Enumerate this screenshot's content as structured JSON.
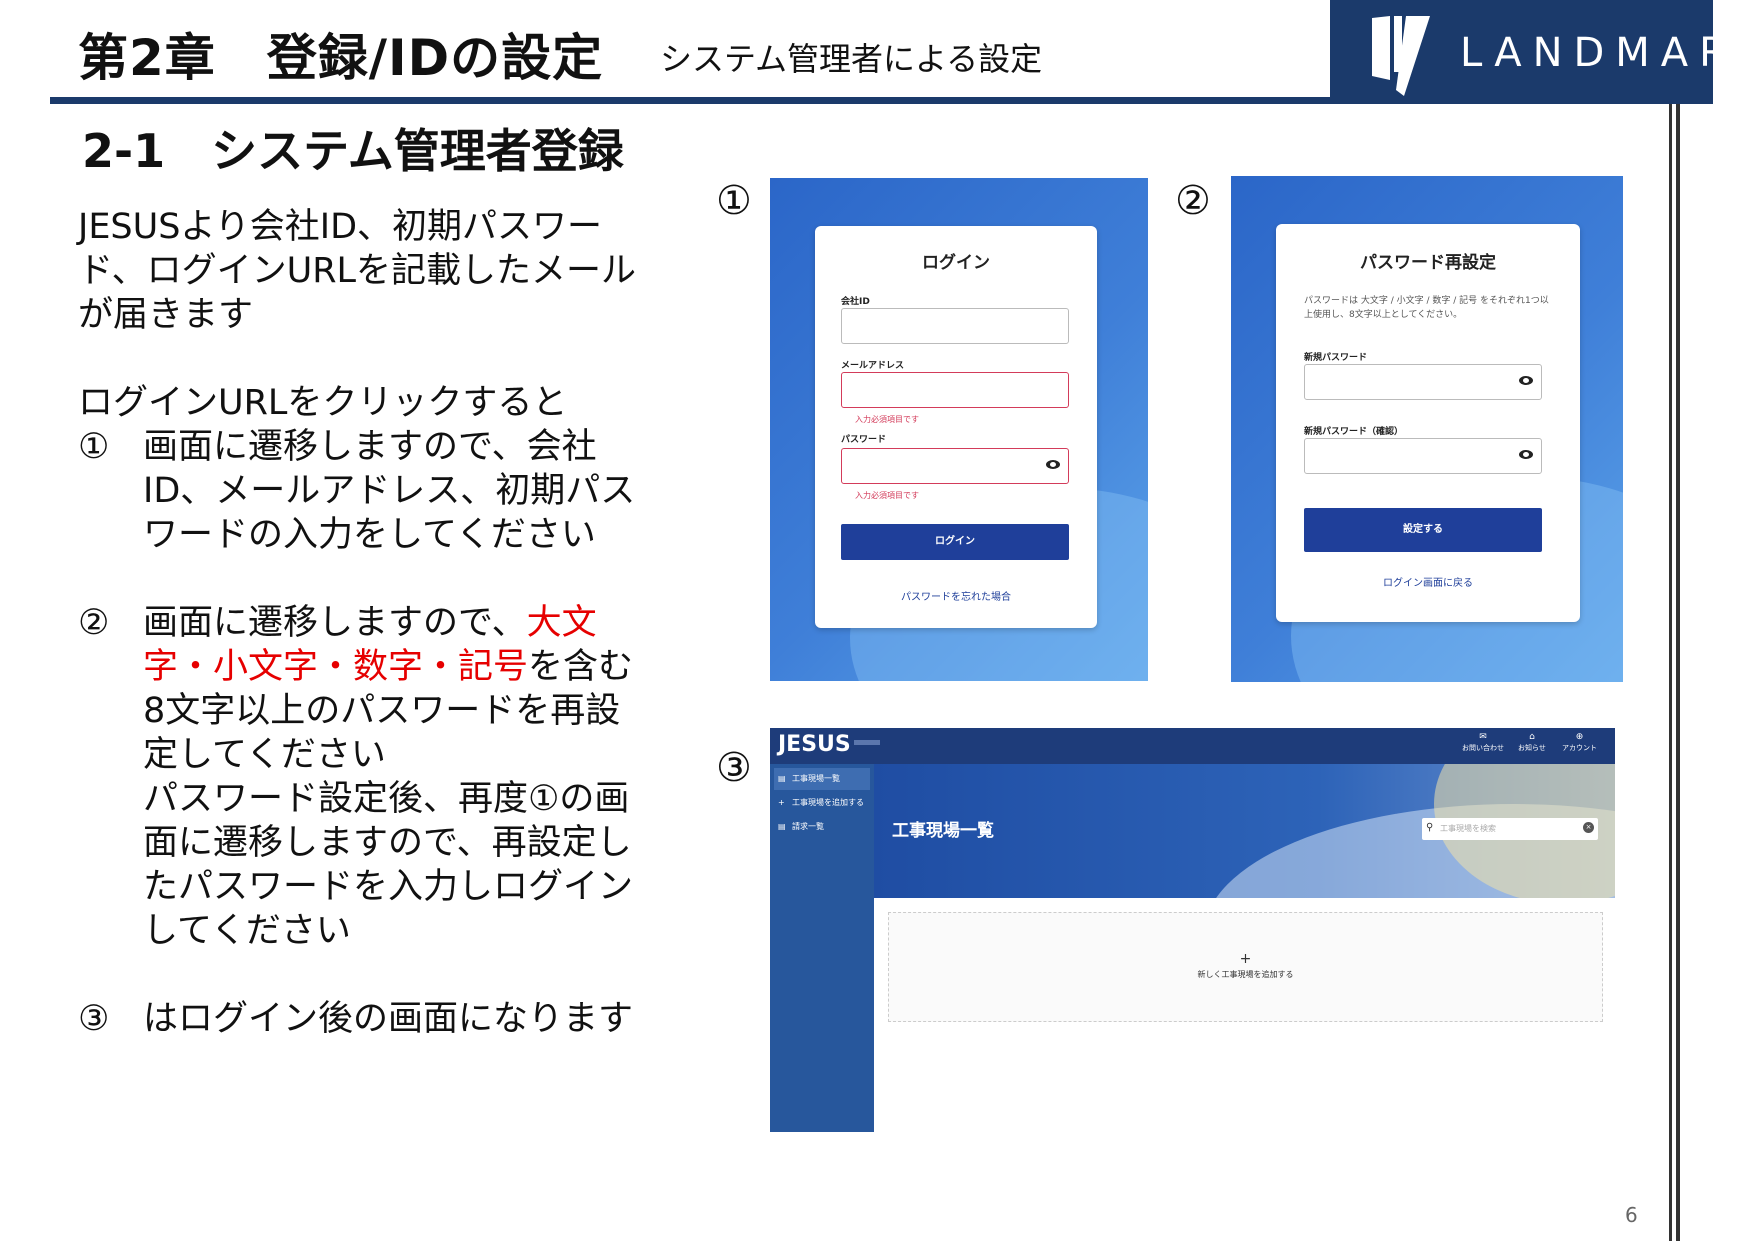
{
  "header": {
    "chapter_title": "第2章　登録/IDの設定",
    "chapter_subtitle": "システム管理者による設定",
    "logo_text": "LANDMARK",
    "rule_color": "#1b3a6b"
  },
  "section": {
    "title": "2-1　システム管理者登録"
  },
  "body": {
    "intro": "JESUSより会社ID、初期パスワード、ログインURLを記載したメールが届きます",
    "lead": "ログインURLをクリックすると",
    "step1": {
      "num": "①",
      "text": "画面に遷移しますので、会社ID、メールアドレス、初期パスワードの入力をしてください"
    },
    "step2": {
      "num": "②",
      "text_before": "画面に遷移しますので、",
      "text_red": "大文字・小文字・数字・記号",
      "text_after": "を含む8文字以上のパスワードを再設定してください",
      "text_2": "パスワード設定後、再度①の画面に遷移しますので、再設定したパスワードを入力しログインしてください"
    },
    "step3": {
      "num": "③",
      "text": "はログイン後の画面になります"
    }
  },
  "screens": {
    "marker1": "①",
    "marker2": "②",
    "marker3": "③",
    "login": {
      "title": "ログイン",
      "company_id_label": "会社ID",
      "email_label": "メールアドレス",
      "email_error": "入力必須項目です",
      "password_label": "パスワード",
      "password_error": "入力必須項目です",
      "login_button": "ログイン",
      "forgot_link": "パスワードを忘れた場合"
    },
    "reset": {
      "title": "パスワード再設定",
      "hint": "パスワードは 大文字 / 小文字 / 数字 / 記号 をそれぞれ1つ以上使用し、8文字以上としてください。",
      "new_password_label": "新規パスワード",
      "confirm_password_label": "新規パスワード（確認）",
      "submit_button": "設定する",
      "back_link": "ログイン画面に戻る"
    },
    "app": {
      "logo": "JESUS",
      "top_contact": "お問い合わせ",
      "top_notice": "お知らせ",
      "top_account": "アカウント",
      "side_sites": "工事現場一覧",
      "side_add": "工事現場を追加する",
      "side_billing": "請求一覧",
      "hero_title": "工事現場一覧",
      "search_placeholder": "工事現場を検索",
      "add_plus": "+",
      "add_label": "新しく工事現場を追加する"
    }
  },
  "footer": {
    "page_number": "6"
  },
  "colors": {
    "accent_red": "#e60000",
    "navy": "#1b3a6b",
    "button_blue": "#1f3f9a"
  }
}
